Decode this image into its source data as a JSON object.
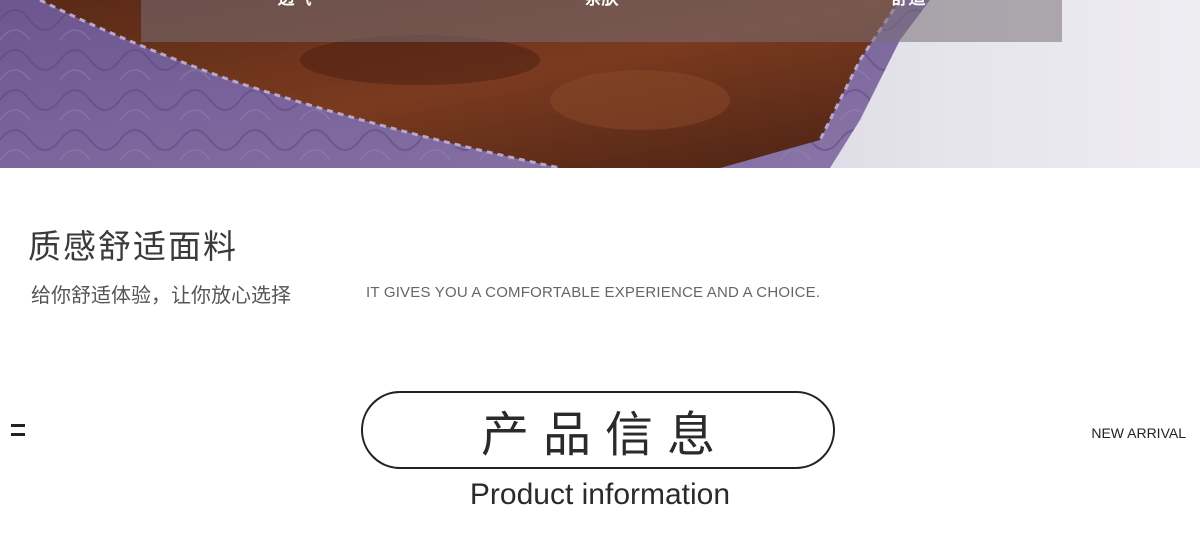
{
  "hero": {
    "features": [
      "透气",
      "亲肤",
      "舒适"
    ]
  },
  "fabric": {
    "title": "质感舒适面料",
    "subtitle_cn": "给你舒适体验，让你放心选择",
    "subtitle_en": "IT GIVES YOU A COMFORTABLE EXPERIENCE AND A CHOICE."
  },
  "product": {
    "title_cn": "产品信息",
    "title_en": "Product information",
    "new_arrival": "NEW ARRIVAL"
  }
}
